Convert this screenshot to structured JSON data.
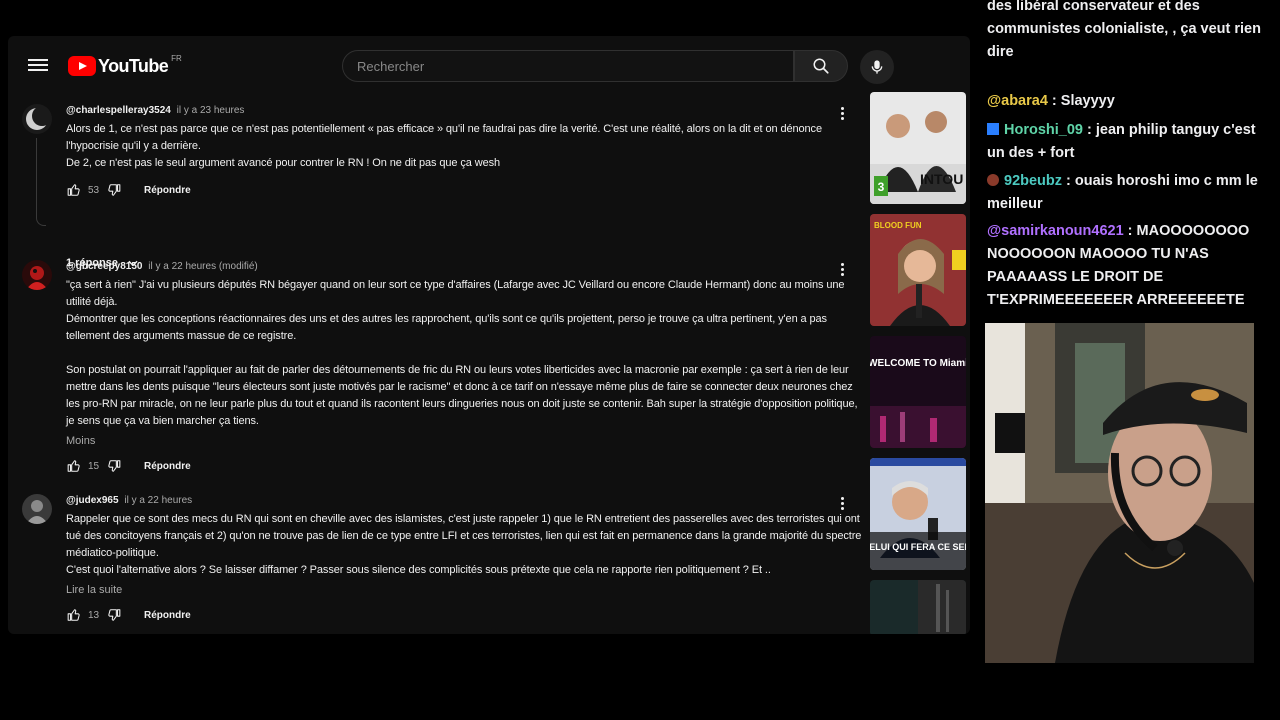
{
  "youtube": {
    "logo_text": "YouTube",
    "country": "FR",
    "search_placeholder": "Rechercher",
    "comments": [
      {
        "author": "@charlespelleray3524",
        "time": "il y a 23 heures",
        "paragraphs": [
          "Alors de 1, ce n'est pas parce que ce n'est pas potentiellement « pas efficace » qu'il ne faudrai pas dire la verité. C'est une réalité, alors on la dit et on dénonce l'hypocrisie qu'il y a derrière.",
          "De 2, ce n'est pas le seul argument avancé pour contrer le RN ! On ne dit pas que ça wesh"
        ],
        "likes": "53",
        "reply_label": "Répondre",
        "replies_label": "1 réponse"
      },
      {
        "author": "@gbcreepy8150",
        "time": "il y a 22 heures (modifié)",
        "paragraphs": [
          "\"ça sert à rien\" J'ai vu plusieurs députés RN bégayer quand on leur sort ce type d'affaires (Lafarge avec JC Veillard ou encore Claude Hermant) donc au moins une utilité déjà.",
          "Démontrer que les conceptions réactionnaires des uns et des autres les rapprochent, qu'ils sont ce qu'ils projettent, perso je trouve ça ultra pertinent, y'en a pas tellement des arguments massue de ce registre.",
          "",
          "Son postulat on pourrait l'appliquer au fait de parler des détournements de fric du RN ou leurs votes liberticides avec la macronie par exemple : ça sert à rien de leur mettre dans les dents puisque \"leurs électeurs sont juste motivés par le racisme\" et donc à ce tarif on n'essaye même plus de faire se connecter deux neurones chez les pro-RN par miracle, on ne leur parle plus du tout et quand ils racontent leurs dingueries nous on doit juste se contenir. Bah super la stratégie d'opposition politique, je sens que ça va bien marcher ça tiens."
        ],
        "more_label": "Moins",
        "likes": "15",
        "reply_label": "Répondre"
      },
      {
        "author": "@judex965",
        "time": "il y a 22 heures",
        "paragraphs": [
          "Rappeler que ce sont des mecs du RN qui sont en cheville avec des islamistes, c'est juste rappeler 1) que le RN entretient des passerelles avec des terroristes qui ont tué des concitoyens français et 2) qu'on ne trouve pas de lien de ce type entre LFI et ces terroristes, lien qui est fait en permanence dans la grande majorité du spectre médiatico-politique.",
          "C'est quoi l'alternative alors ? Se laisser diffamer ? Passer sous silence des complicités sous prétexte que cela ne rapporte rien politiquement ? Et .."
        ],
        "more_label": "Lire la suite",
        "likes": "13",
        "reply_label": "Répondre"
      }
    ],
    "thumbnails": [
      {
        "caption": "INTOU",
        "badge": "3"
      },
      {
        "caption": "BLOOD FUN"
      },
      {
        "caption": "WELCOME TO Miami"
      },
      {
        "caption": "\"CELUI QUI FERA CE SERA"
      },
      {
        "caption": ""
      }
    ]
  },
  "chat": {
    "messages": [
      {
        "user": "",
        "text": "des libéral conservateur et des communistes colonialiste, , ça veut rien dire",
        "color": "#efeff1"
      },
      {
        "user": "@abara4",
        "text": " : Slayyyy",
        "color": "#e8c848"
      },
      {
        "user": "Horoshi_09",
        "text": " : jean philip tanguy c'est un des + fort",
        "color": "#5fd4a8",
        "badge_color": "#2a7fff"
      },
      {
        "user": "92beubz",
        "text": " : ouais horoshi imo c mm le meilleur",
        "color": "#4cc9c0",
        "badge_color": "#8a3a2a"
      },
      {
        "user": "@samirkanoun4621",
        "text": " : MAOOOOOOOO NOOOOOON MAOOOO TU N'AS PAAAAASS LE DROIT DE T'EXPRIMEEEEEEER ARREEEEEETE",
        "color": "#b070ff"
      }
    ]
  }
}
